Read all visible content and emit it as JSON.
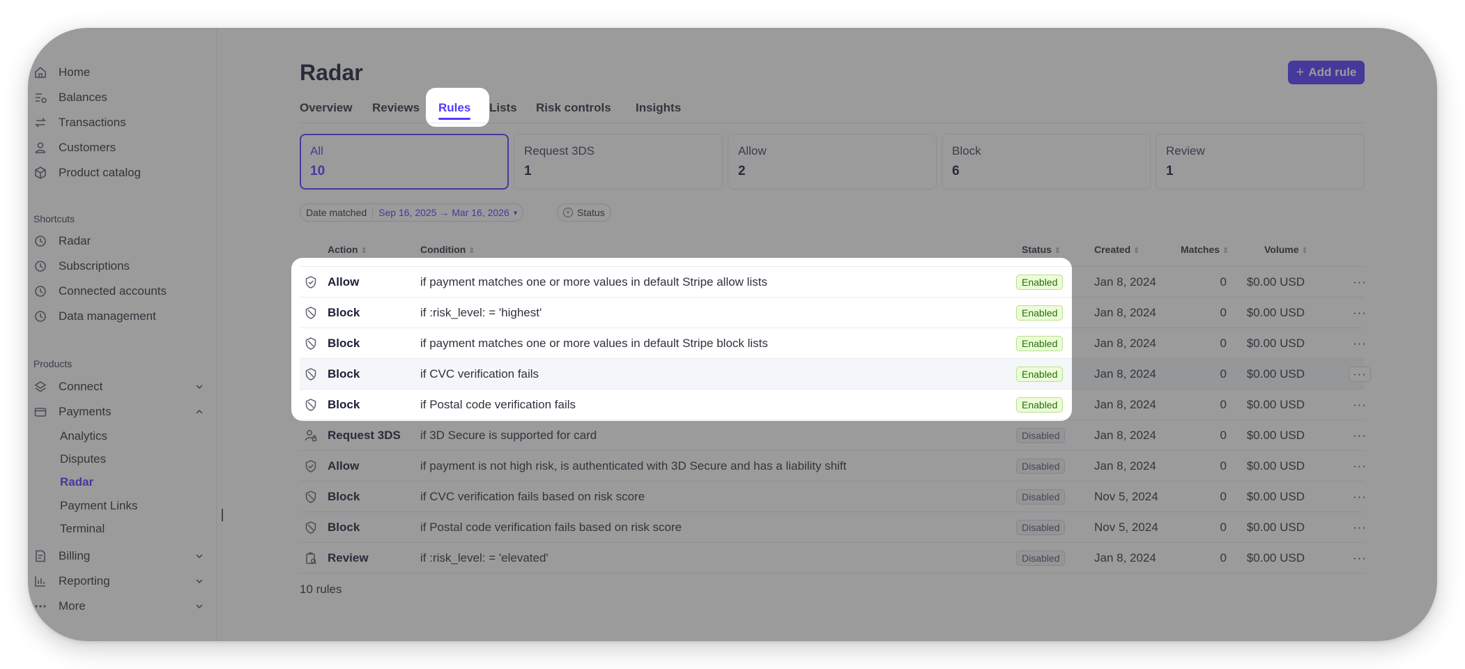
{
  "sidebar": {
    "top_items": [
      {
        "label": "Home",
        "icon": "home-icon"
      },
      {
        "label": "Balances",
        "icon": "balances-icon"
      },
      {
        "label": "Transactions",
        "icon": "transactions-icon"
      },
      {
        "label": "Customers",
        "icon": "customers-icon"
      },
      {
        "label": "Product catalog",
        "icon": "product-catalog-icon"
      }
    ],
    "shortcuts_label": "Shortcuts",
    "shortcuts": [
      {
        "label": "Radar",
        "icon": "clock-icon"
      },
      {
        "label": "Subscriptions",
        "icon": "clock-icon"
      },
      {
        "label": "Connected accounts",
        "icon": "clock-icon"
      },
      {
        "label": "Data management",
        "icon": "clock-icon"
      }
    ],
    "products_label": "Products",
    "connect": {
      "label": "Connect",
      "icon": "connect-icon"
    },
    "payments": {
      "label": "Payments",
      "icon": "payments-icon"
    },
    "payments_sub": [
      {
        "label": "Analytics",
        "active": false
      },
      {
        "label": "Disputes",
        "active": false
      },
      {
        "label": "Radar",
        "active": true
      },
      {
        "label": "Payment Links",
        "active": false
      },
      {
        "label": "Terminal",
        "active": false
      }
    ],
    "billing": {
      "label": "Billing",
      "icon": "billing-icon"
    },
    "reporting": {
      "label": "Reporting",
      "icon": "reporting-icon"
    },
    "more": {
      "label": "More",
      "icon": "more-icon"
    }
  },
  "header": {
    "title": "Radar",
    "add_button": "Add rule"
  },
  "tabs": [
    {
      "label": "Overview",
      "active": false
    },
    {
      "label": "Reviews",
      "active": false
    },
    {
      "label": "Rules",
      "active": true
    },
    {
      "label": "Lists",
      "active": false
    },
    {
      "label": "Risk controls",
      "active": false
    },
    {
      "label": "Insights",
      "active": false
    }
  ],
  "summary_cards": [
    {
      "label": "All",
      "count": "10",
      "active": true
    },
    {
      "label": "Request 3DS",
      "count": "1",
      "active": false
    },
    {
      "label": "Allow",
      "count": "2",
      "active": false
    },
    {
      "label": "Block",
      "count": "6",
      "active": false
    },
    {
      "label": "Review",
      "count": "1",
      "active": false
    }
  ],
  "filters": {
    "date_label": "Date matched",
    "date_value": "Sep 16, 2025 → Mar 16, 2026",
    "status_label": "Status"
  },
  "table": {
    "columns": {
      "action": "Action",
      "condition": "Condition",
      "status": "Status",
      "created": "Created",
      "matches": "Matches",
      "volume": "Volume"
    },
    "rows": [
      {
        "icon": "allow-shield-icon",
        "action": "Allow",
        "condition": "if payment matches one or more values in default Stripe allow lists",
        "status": "Enabled",
        "created": "Jan 8, 2024",
        "matches": "0",
        "volume": "$0.00 USD"
      },
      {
        "icon": "block-shield-icon",
        "action": "Block",
        "condition": "if :risk_level: = 'highest'",
        "status": "Enabled",
        "created": "Jan 8, 2024",
        "matches": "0",
        "volume": "$0.00 USD"
      },
      {
        "icon": "block-shield-icon",
        "action": "Block",
        "condition": "if payment matches one or more values in default Stripe block lists",
        "status": "Enabled",
        "created": "Jan 8, 2024",
        "matches": "0",
        "volume": "$0.00 USD"
      },
      {
        "icon": "block-shield-icon",
        "action": "Block",
        "condition": "if CVC verification fails",
        "status": "Enabled",
        "created": "Jan 8, 2024",
        "matches": "0",
        "volume": "$0.00 USD"
      },
      {
        "icon": "block-shield-icon",
        "action": "Block",
        "condition": "if Postal code verification fails",
        "status": "Enabled",
        "created": "Jan 8, 2024",
        "matches": "0",
        "volume": "$0.00 USD"
      },
      {
        "icon": "request-3ds-icon",
        "action": "Request 3DS",
        "condition": "if 3D Secure is supported for card",
        "status": "Disabled",
        "created": "Jan 8, 2024",
        "matches": "0",
        "volume": "$0.00 USD"
      },
      {
        "icon": "allow-shield-icon",
        "action": "Allow",
        "condition": "if payment is not high risk, is authenticated with 3D Secure and has a liability shift",
        "status": "Disabled",
        "created": "Jan 8, 2024",
        "matches": "0",
        "volume": "$0.00 USD"
      },
      {
        "icon": "block-shield-icon",
        "action": "Block",
        "condition": "if CVC verification fails based on risk score",
        "status": "Disabled",
        "created": "Nov 5, 2024",
        "matches": "0",
        "volume": "$0.00 USD"
      },
      {
        "icon": "block-shield-icon",
        "action": "Block",
        "condition": "if Postal code verification fails based on risk score",
        "status": "Disabled",
        "created": "Nov 5, 2024",
        "matches": "0",
        "volume": "$0.00 USD"
      },
      {
        "icon": "review-icon",
        "action": "Review",
        "condition": "if :risk_level: = 'elevated'",
        "status": "Disabled",
        "created": "Jan 8, 2024",
        "matches": "0",
        "volume": "$0.00 USD"
      }
    ],
    "more_label": "···",
    "footer": "10 rules"
  }
}
